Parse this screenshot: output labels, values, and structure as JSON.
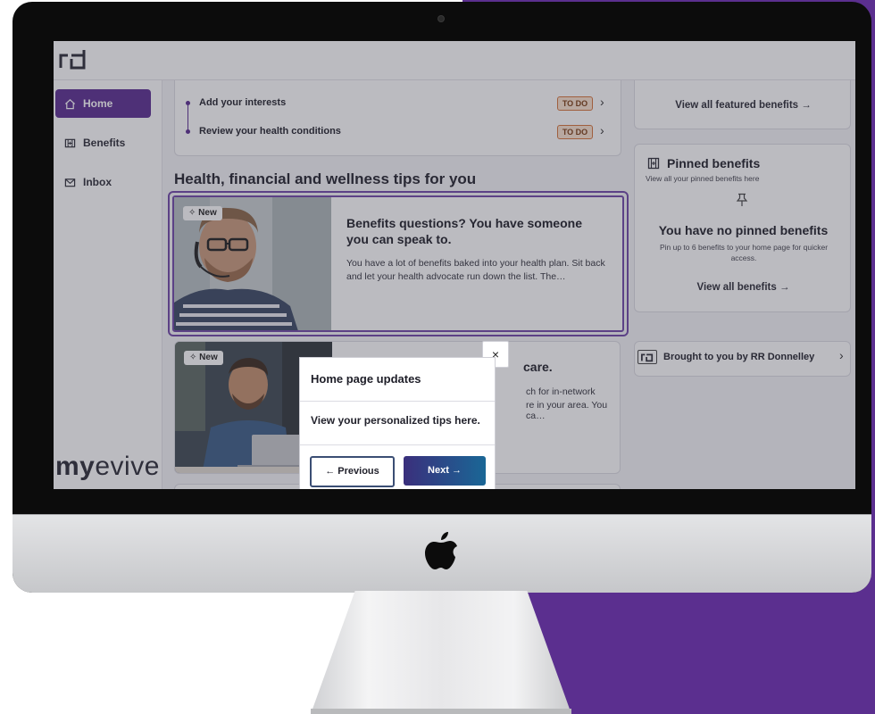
{
  "app": {
    "logo": "rd"
  },
  "sidebar": {
    "items": [
      {
        "label": "Home",
        "icon": "home-icon",
        "active": true
      },
      {
        "label": "Benefits",
        "icon": "benefits-icon",
        "active": false
      },
      {
        "label": "Inbox",
        "icon": "inbox-icon",
        "active": false
      }
    ],
    "brand_prefix": "my",
    "brand_suffix": "evive"
  },
  "todos": [
    {
      "label": "Add your interests",
      "status": "TO DO"
    },
    {
      "label": "Review your health conditions",
      "status": "TO DO"
    }
  ],
  "main": {
    "section_title": "Health, financial and wellness tips for you",
    "tips": [
      {
        "badge": "New",
        "title": "Benefits questions? You have someone you can speak to.",
        "body": "You have a lot of benefits baked into your health plan. Sit back and let your health advocate run down the list. The…"
      },
      {
        "badge": "New",
        "title_fragment": "care.",
        "body_line1": "ch for in-network",
        "body_line2": "re in your area. You ca…"
      }
    ]
  },
  "right": {
    "featured_link": "View all featured benefits →",
    "pinned": {
      "title": "Pinned benefits",
      "subtitle": "View all your pinned benefits here",
      "empty_title": "You have no pinned benefits",
      "empty_help": "Pin up to 6 benefits to your home page for quicker access.",
      "link": "View all benefits →"
    },
    "brought_by": "Brought to you by RR Donnelley"
  },
  "popover": {
    "title": "Home page updates",
    "text": "View your personalized tips here.",
    "prev_label": "← Previous",
    "next_label": "Next →",
    "close_label": "×"
  },
  "colors": {
    "accent_purple": "#5a2d91",
    "background_purple": "#5b2f8f",
    "todo_badge_bg": "#fbe2cf",
    "todo_badge_border": "#d6743a",
    "next_button_start": "#3a2f7c",
    "next_button_end": "#1a6796"
  }
}
